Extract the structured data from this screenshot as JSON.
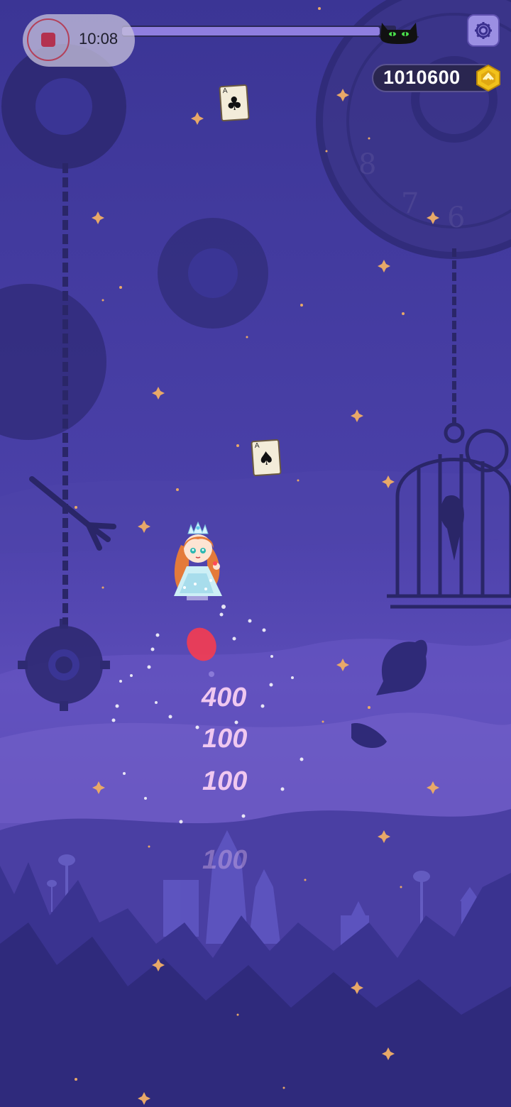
{
  "recording": {
    "time": "10:08",
    "stop_icon": "stop-icon"
  },
  "level_progress": {
    "fraction": 0.94,
    "end_marker_icon": "black-cat-icon"
  },
  "settings": {
    "icon": "gear-icon"
  },
  "score": {
    "value": "1010600",
    "icon": "gold-coin-icon"
  },
  "cards": [
    {
      "rank": "A",
      "suit": "♣"
    },
    {
      "rank": "A",
      "suit": "♠"
    }
  ],
  "floating_scores": [
    "400",
    "100",
    "100",
    "100"
  ],
  "clock_numerals": [
    "8",
    "7",
    "6"
  ],
  "colors": {
    "accent": "#8f7ee0",
    "sky": "#3b3595",
    "coin": "#f2c21b"
  }
}
